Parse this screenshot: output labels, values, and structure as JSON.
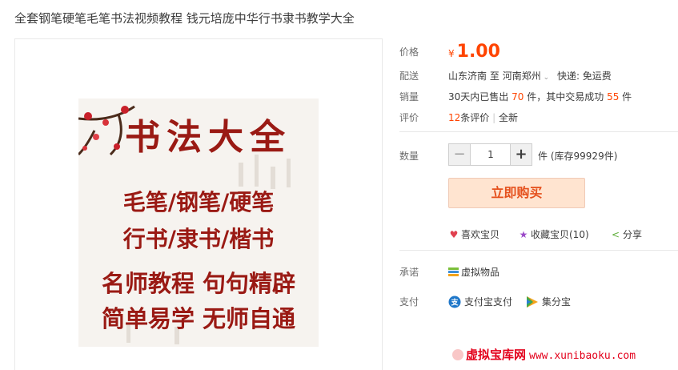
{
  "title": "全套钢笔硬笔毛笔书法视频教程 钱元培庞中华行书隶书教学大全",
  "poster": {
    "headline": "书法大全",
    "line1": "毛笔/钢笔/硬笔",
    "line2": "行书/隶书/楷书",
    "line3": "名师教程 句句精辟",
    "line4": "简单易学 无师自通"
  },
  "price": {
    "label": "价格",
    "currency": "¥",
    "value": "1.00"
  },
  "delivery": {
    "label": "配送",
    "from": "山东济南",
    "to_word": "至",
    "to": "河南郑州",
    "chevron": "chevron-down-icon",
    "shipping": "快递: 免运费"
  },
  "sales": {
    "label": "销量",
    "prefix": "30天内已售出",
    "sold": "70",
    "mid": "件，其中交易成功",
    "success": "55",
    "suffix": "件"
  },
  "reviews": {
    "label": "评价",
    "count": "12",
    "count_suffix": "条评价",
    "divider": "|",
    "tag": "全新"
  },
  "quantity": {
    "label": "数量",
    "minus": "−",
    "plus": "+",
    "value": "1",
    "unit": "件",
    "stock": "(库存99929件)"
  },
  "buy_button": "立即购买",
  "actions": {
    "like": {
      "icon": "heart-icon",
      "label": "喜欢宝贝"
    },
    "fav": {
      "icon": "star-icon",
      "label": "收藏宝贝(10)"
    },
    "share": {
      "icon": "share-icon",
      "label": "分享"
    }
  },
  "promise": {
    "label": "承诺",
    "icon": "virtual-goods-icon",
    "text": "虚拟物品"
  },
  "payment": {
    "label": "支付",
    "methods": [
      {
        "icon": "alipay-icon",
        "name": "支付宝支付"
      },
      {
        "icon": "jifenbao-icon",
        "name": "集分宝"
      }
    ]
  },
  "watermark": {
    "cn": "虚拟宝库网",
    "url": "www.xunibaoku.com"
  },
  "colors": {
    "accent": "#ff4400",
    "brand_red": "#9a1a14",
    "buy_bg": "#ffe4d0",
    "buy_text": "#e5511d",
    "label": "#6c6c6c"
  }
}
